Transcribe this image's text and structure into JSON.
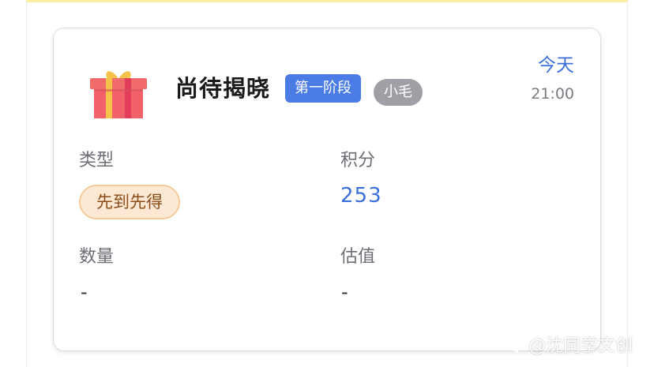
{
  "card": {
    "title": "尚待揭晓",
    "stage_badge": "第一阶段",
    "owner_badge": "小毛",
    "date": "今天",
    "time": "21:00",
    "gift_icon": "gift-icon",
    "fields": {
      "type_label": "类型",
      "type_value": "先到先得",
      "points_label": "积分",
      "points_value": "253",
      "quantity_label": "数量",
      "quantity_value": "-",
      "valuation_label": "估值",
      "valuation_value": "-"
    }
  },
  "watermark": {
    "text": "@沈同学文创"
  },
  "colors": {
    "accent_blue": "#3b6fdc",
    "stage_badge_bg": "#4b7be5",
    "owner_badge_bg": "#9ea0a6",
    "type_tag_bg": "#fde9d3",
    "type_tag_text": "#8a4d1a",
    "top_border_yellow": "#fbeea0"
  }
}
